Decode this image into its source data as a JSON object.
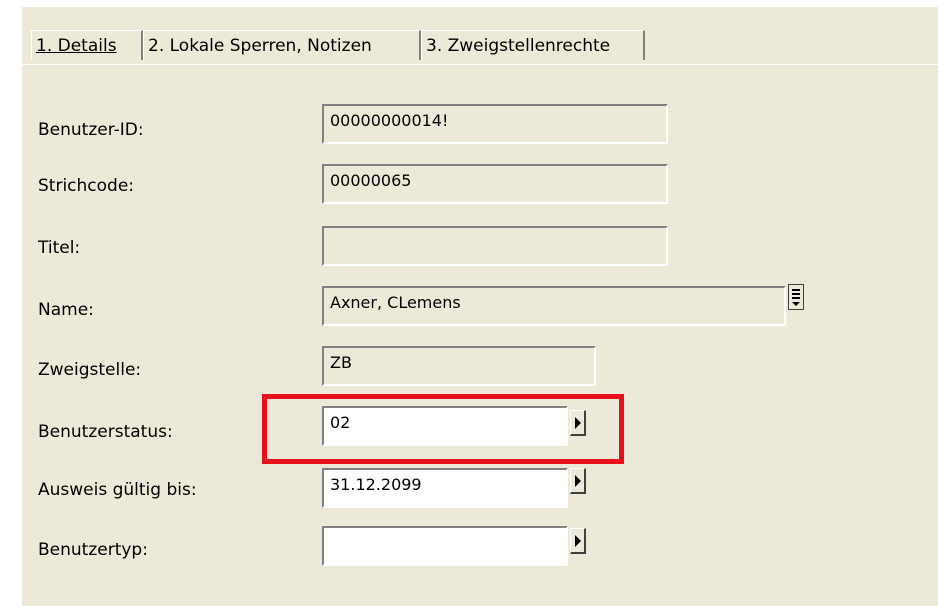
{
  "tabs": [
    {
      "label": "1. Details",
      "active": true
    },
    {
      "label": "2. Lokale Sperren, Notizen",
      "active": false
    },
    {
      "label": "3. Zweigstellenrechte",
      "active": false
    }
  ],
  "form": {
    "user_id": {
      "label": "Benutzer-ID:",
      "value": "00000000014!"
    },
    "barcode": {
      "label": "Strichcode:",
      "value": "00000065"
    },
    "title": {
      "label": "Titel:",
      "value": ""
    },
    "name": {
      "label": "Name:",
      "value": "Axner, CLemens"
    },
    "branch": {
      "label": "Zweigstelle:",
      "value": "ZB"
    },
    "status": {
      "label": "Benutzerstatus:",
      "value": "02"
    },
    "valid_until": {
      "label": "Ausweis gültig bis:",
      "value": "31.12.2099"
    },
    "user_type": {
      "label": "Benutzertyp:",
      "value": ""
    }
  },
  "icons": {
    "name_lookup": "list-lookup-icon",
    "arrow": "right-arrow-icon"
  },
  "colors": {
    "panel_background": "#ece9d8",
    "highlight_border": "#e8101a"
  }
}
